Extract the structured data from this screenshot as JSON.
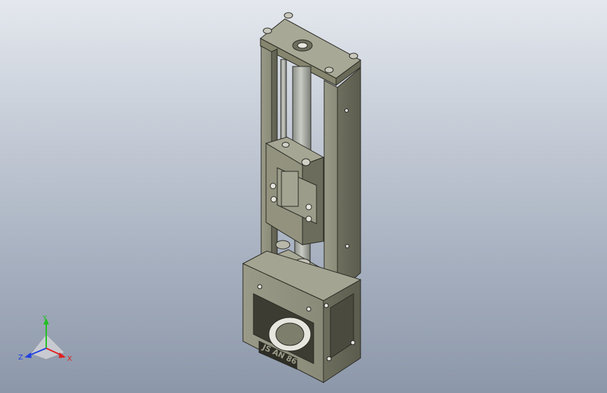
{
  "viewport": {
    "background_top": "#e4e8ee",
    "background_bottom": "#8c97a9"
  },
  "model": {
    "body_color": "#8a8a78",
    "engraving_text": "JS AN 86"
  },
  "triad": {
    "x_label": "X",
    "y_label": "Y",
    "z_label": "Z",
    "x_color": "#e02020",
    "y_color": "#20c020",
    "z_color": "#2040e0"
  }
}
